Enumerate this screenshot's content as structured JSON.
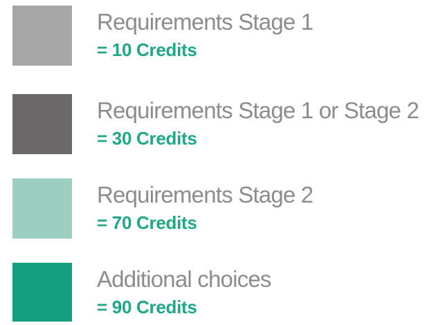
{
  "colors": {
    "credits_text": "#1fa888",
    "label_text": "#8c8c8c"
  },
  "legend": {
    "items": [
      {
        "label": "Requirements Stage 1",
        "credits": "= 10 Credits",
        "color": "#a6a6a6"
      },
      {
        "label": "Requirements Stage 1 or Stage 2",
        "credits": "= 30 Credits",
        "color": "#6b6969"
      },
      {
        "label": "Requirements Stage 2",
        "credits": "= 70 Credits",
        "color": "#9dcfc0"
      },
      {
        "label": "Additional choices",
        "credits": "= 90 Credits",
        "color": "#14a07f"
      }
    ]
  }
}
